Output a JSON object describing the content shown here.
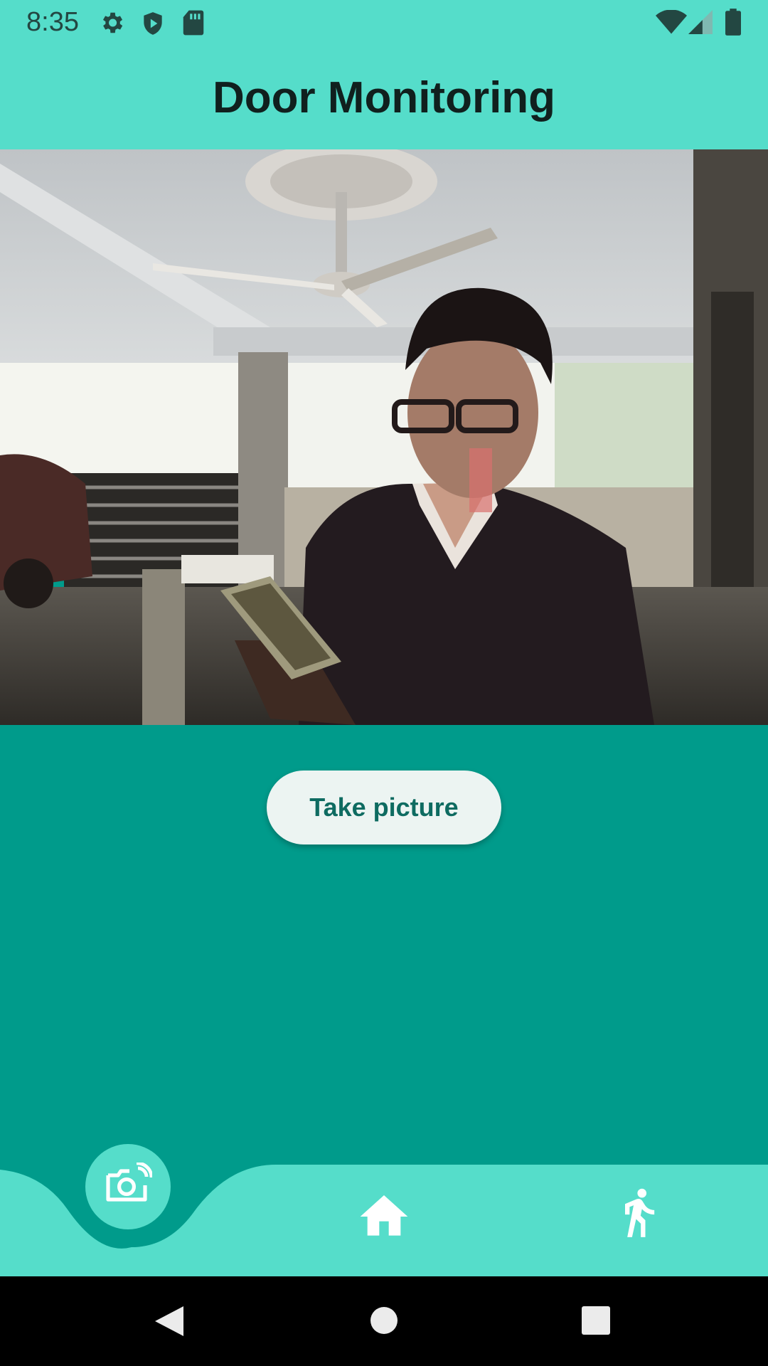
{
  "status_bar": {
    "time": "8:35",
    "left_icons": [
      "gear-icon",
      "shield-play-icon",
      "sd-card-icon"
    ],
    "right_icons": [
      "wifi-icon",
      "cell-signal-icon",
      "battery-icon"
    ]
  },
  "app_bar": {
    "title": "Door Monitoring"
  },
  "camera": {
    "content": "live-camera-image"
  },
  "actions": {
    "take_picture_label": "Take picture"
  },
  "bottom_nav": {
    "active_index": 0,
    "items": [
      {
        "icon": "camera-icon"
      },
      {
        "icon": "home-icon"
      },
      {
        "icon": "running-person-icon"
      }
    ]
  },
  "system_nav": {
    "buttons": [
      "back-icon",
      "home-circle-icon",
      "recents-icon"
    ]
  },
  "colors": {
    "header_teal": "#55ddca",
    "body_teal": "#009b8b",
    "button_bg": "#ecf4f2",
    "button_text": "#0e6b61"
  }
}
